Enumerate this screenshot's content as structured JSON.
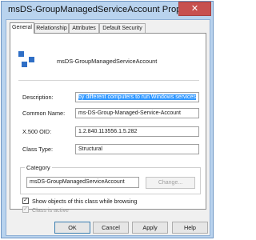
{
  "window": {
    "title": "msDS-GroupManagedServiceAccount Properties",
    "close_glyph": "✕"
  },
  "tabs": [
    {
      "label": "General",
      "active": true
    },
    {
      "label": "Relationship",
      "active": false
    },
    {
      "label": "Attributes",
      "active": false
    },
    {
      "label": "Default Security",
      "active": false
    }
  ],
  "general": {
    "icon": "class-icon",
    "class_name": "msDS-GroupManagedServiceAccount",
    "fields": {
      "description": {
        "label": "Description:",
        "value": "by different computers to run Windows services"
      },
      "common_name": {
        "label": "Common Name:",
        "value": "ms-DS-Group-Managed-Service-Account"
      },
      "x500_oid": {
        "label": "X.500 OID:",
        "value": "1.2.840.113556.1.5.282"
      },
      "class_type": {
        "label": "Class Type:",
        "value": "Structural"
      }
    },
    "category": {
      "group_label": "Category",
      "value": "msDS-GroupManagedServiceAccount",
      "change_button": "Change..."
    },
    "checkboxes": {
      "show_objects": {
        "label": "Show objects of this class while browsing",
        "checked": true,
        "enabled": true
      },
      "class_active": {
        "label": "Class is active",
        "checked": true,
        "enabled": false
      }
    }
  },
  "buttons": {
    "ok": "OK",
    "cancel": "Cancel",
    "apply": "Apply",
    "help": "Help"
  },
  "colors": {
    "title_bar": "#b9d3ee",
    "close_button": "#c7504f",
    "selection": "#3399ff",
    "icon_blue": "#2f6fc6"
  }
}
